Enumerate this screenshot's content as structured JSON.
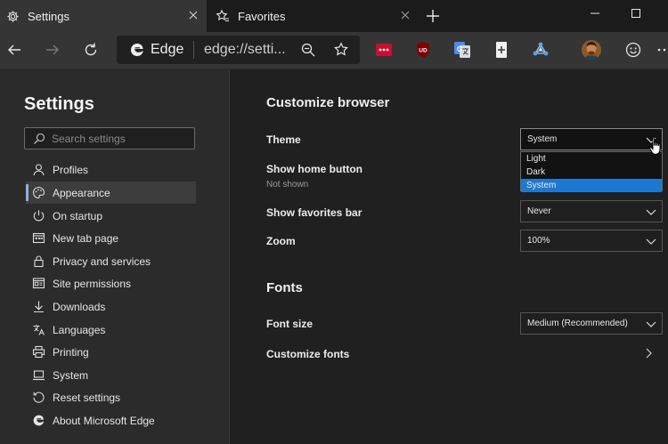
{
  "tabs": [
    {
      "title": "Settings",
      "icon": "gear-icon",
      "active": true
    },
    {
      "title": "Favorites",
      "icon": "favorites-star-icon",
      "active": false
    }
  ],
  "toolbar": {
    "brand": "Edge",
    "url": "edge://setti..."
  },
  "sidebar": {
    "title": "Settings",
    "search_placeholder": "Search settings",
    "items": [
      {
        "label": "Profiles",
        "icon": "profile-icon",
        "selected": false
      },
      {
        "label": "Appearance",
        "icon": "palette-icon",
        "selected": true
      },
      {
        "label": "On startup",
        "icon": "power-icon",
        "selected": false
      },
      {
        "label": "New tab page",
        "icon": "new-tab-page-icon",
        "selected": false
      },
      {
        "label": "Privacy and services",
        "icon": "lock-icon",
        "selected": false
      },
      {
        "label": "Site permissions",
        "icon": "site-permissions-icon",
        "selected": false
      },
      {
        "label": "Downloads",
        "icon": "download-icon",
        "selected": false
      },
      {
        "label": "Languages",
        "icon": "languages-icon",
        "selected": false
      },
      {
        "label": "Printing",
        "icon": "printer-icon",
        "selected": false
      },
      {
        "label": "System",
        "icon": "laptop-icon",
        "selected": false
      },
      {
        "label": "Reset settings",
        "icon": "reset-icon",
        "selected": false
      },
      {
        "label": "About Microsoft Edge",
        "icon": "edge-logo-icon",
        "selected": false
      }
    ]
  },
  "main": {
    "section_customize": "Customize browser",
    "theme": {
      "label": "Theme",
      "value": "System",
      "options": [
        "Light",
        "Dark",
        "System"
      ],
      "highlighted": "System"
    },
    "home_button": {
      "label": "Show home button",
      "sub": "Not shown"
    },
    "favorites_bar": {
      "label": "Show favorites bar",
      "value": "Never"
    },
    "zoom": {
      "label": "Zoom",
      "value": "100%"
    },
    "section_fonts": "Fonts",
    "font_size": {
      "label": "Font size",
      "value": "Medium (Recommended)"
    },
    "customize_fonts": {
      "label": "Customize fonts"
    }
  },
  "colors": {
    "accent_highlight": "#1d79d0",
    "selected_indicator": "#8fb0d8",
    "sidebar_bg": "#2b2b2b",
    "main_bg": "#202020"
  }
}
